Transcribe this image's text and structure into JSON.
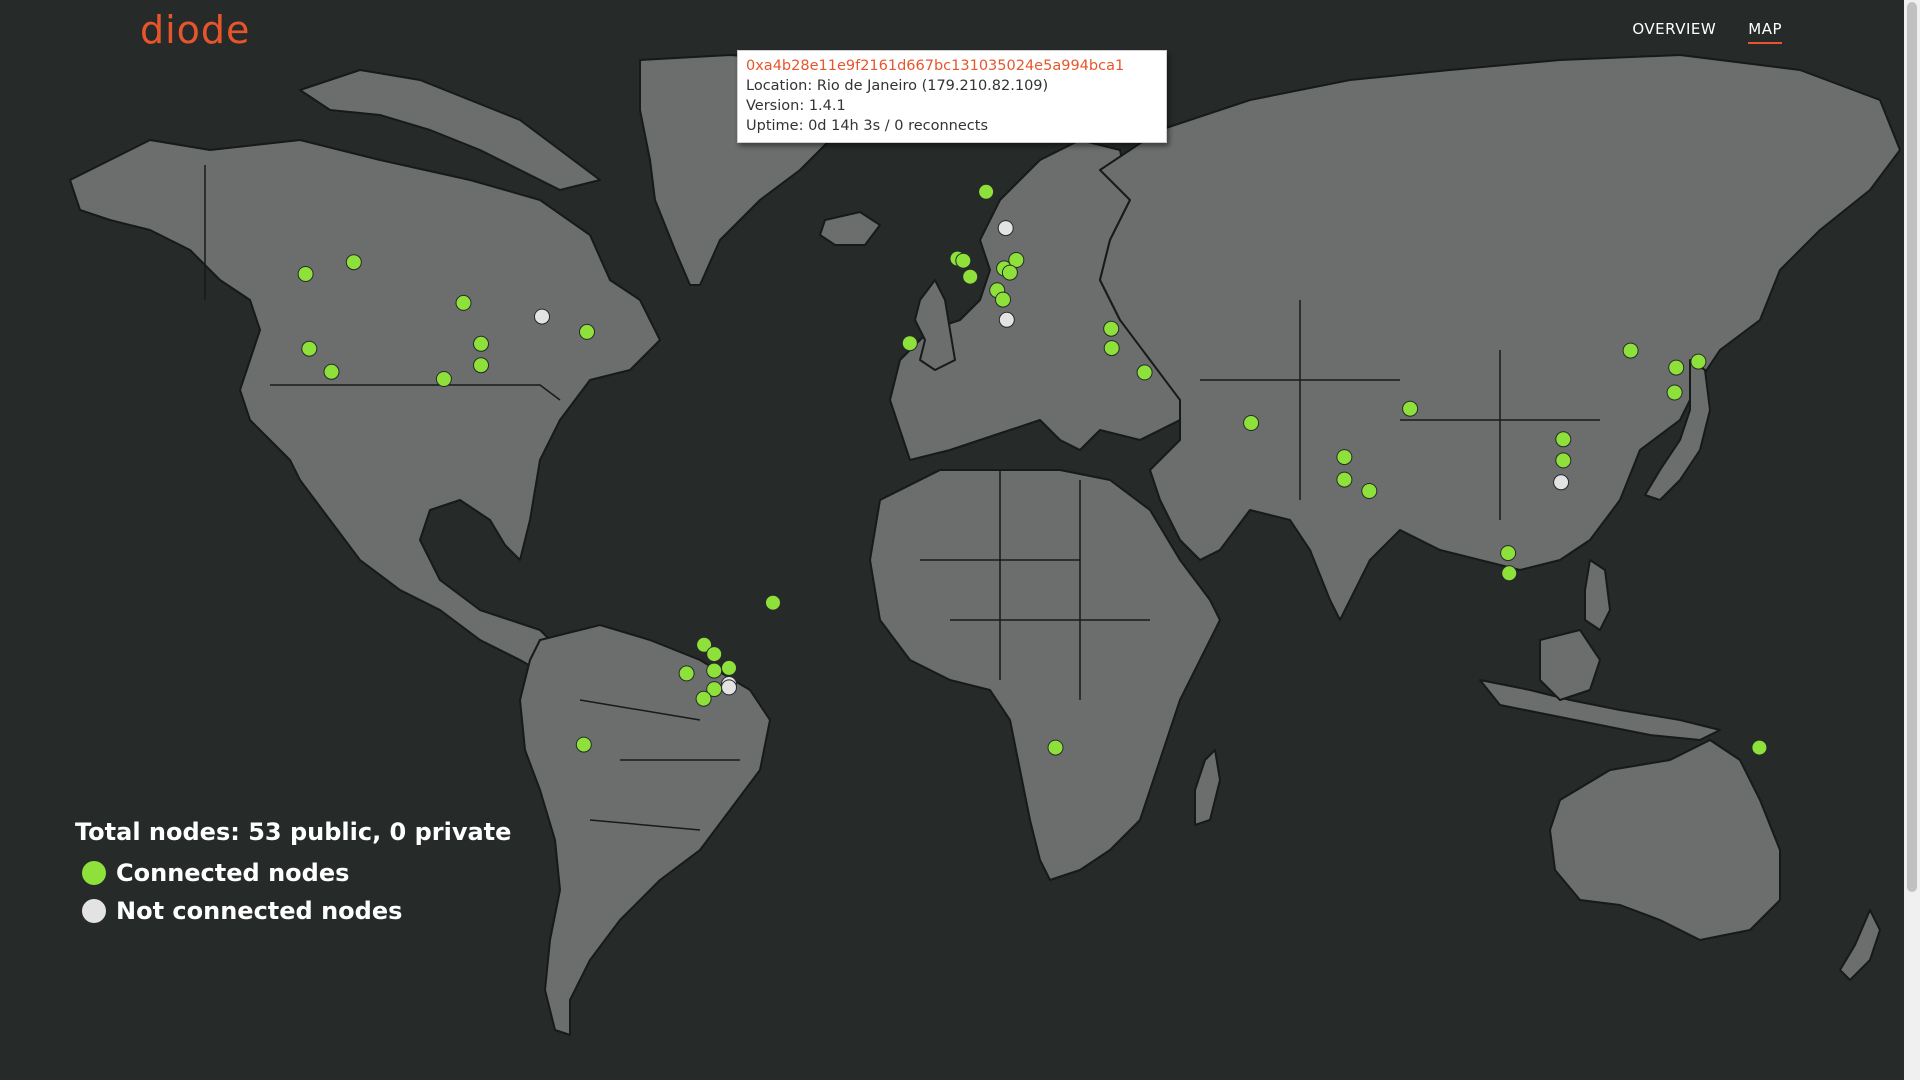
{
  "header": {
    "logo_text": "diode",
    "nav": [
      {
        "label": "OVERVIEW",
        "active": false
      },
      {
        "label": "MAP",
        "active": true
      }
    ]
  },
  "tooltip": {
    "address": "0xa4b28e11e9f2161d667bc131035024e5a994bca1",
    "location": "Location: Rio de Janeiro (179.210.82.109)",
    "version": "Version: 1.4.1",
    "uptime": "Uptime: 0d 14h 3s / 0 reconnects"
  },
  "legend": {
    "total": "Total nodes: 53 public, 0 private",
    "connected_label": "Connected nodes",
    "not_connected_label": "Not connected nodes"
  },
  "colors": {
    "connected": "#8ee03b",
    "not_connected": "#e3e3e3",
    "accent": "#e8552c",
    "land": "#6b6e6d",
    "ocean": "#262b2a"
  },
  "nodes": [
    {
      "lon": -114.0,
      "lat": 51.0,
      "connected": true
    },
    {
      "lon": -123.1,
      "lat": 49.3,
      "connected": true
    },
    {
      "lon": -122.4,
      "lat": 37.8,
      "connected": true
    },
    {
      "lon": -118.2,
      "lat": 34.0,
      "connected": true
    },
    {
      "lon": -93.3,
      "lat": 45.0,
      "connected": true
    },
    {
      "lon": -90.0,
      "lat": 38.6,
      "connected": true
    },
    {
      "lon": -90.0,
      "lat": 35.1,
      "connected": true
    },
    {
      "lon": -97.0,
      "lat": 32.8,
      "connected": true
    },
    {
      "lon": -78.5,
      "lat": 42.9,
      "connected": false
    },
    {
      "lon": -70.0,
      "lat": 40.5,
      "connected": true
    },
    {
      "lon": 5.3,
      "lat": 60.4,
      "connected": true
    },
    {
      "lon": 9.0,
      "lat": 55.7,
      "connected": false
    },
    {
      "lon": -0.1,
      "lat": 51.5,
      "connected": true
    },
    {
      "lon": 1.0,
      "lat": 51.2,
      "connected": true
    },
    {
      "lon": 2.3,
      "lat": 48.9,
      "connected": true
    },
    {
      "lon": 8.7,
      "lat": 50.1,
      "connected": true
    },
    {
      "lon": 11.0,
      "lat": 51.3,
      "connected": true
    },
    {
      "lon": 9.8,
      "lat": 49.5,
      "connected": true
    },
    {
      "lon": 7.4,
      "lat": 46.9,
      "connected": true
    },
    {
      "lon": 8.5,
      "lat": 45.5,
      "connected": true
    },
    {
      "lon": 9.2,
      "lat": 42.4,
      "connected": false
    },
    {
      "lon": -9.1,
      "lat": 38.7,
      "connected": true
    },
    {
      "lon": 28.9,
      "lat": 41.0,
      "connected": true
    },
    {
      "lon": 29.0,
      "lat": 37.9,
      "connected": true
    },
    {
      "lon": 35.2,
      "lat": 33.9,
      "connected": true
    },
    {
      "lon": 55.3,
      "lat": 25.2,
      "connected": true
    },
    {
      "lon": 72.9,
      "lat": 19.1,
      "connected": true
    },
    {
      "lon": 72.9,
      "lat": 15.0,
      "connected": true
    },
    {
      "lon": 77.6,
      "lat": 12.9,
      "connected": true
    },
    {
      "lon": 85.3,
      "lat": 27.7,
      "connected": true
    },
    {
      "lon": 114.2,
      "lat": 22.3,
      "connected": true
    },
    {
      "lon": 114.2,
      "lat": 18.5,
      "connected": true
    },
    {
      "lon": 113.8,
      "lat": 14.5,
      "connected": false
    },
    {
      "lon": 103.8,
      "lat": 1.3,
      "connected": true
    },
    {
      "lon": 104.0,
      "lat": -2.5,
      "connected": true
    },
    {
      "lon": 126.9,
      "lat": 37.5,
      "connected": true
    },
    {
      "lon": 135.5,
      "lat": 34.7,
      "connected": true
    },
    {
      "lon": 139.7,
      "lat": 35.7,
      "connected": true
    },
    {
      "lon": 135.2,
      "lat": 30.5,
      "connected": true
    },
    {
      "lon": 151.2,
      "lat": -33.9,
      "connected": true
    },
    {
      "lon": 18.4,
      "lat": -33.9,
      "connected": true
    },
    {
      "lon": -34.9,
      "lat": -8.0,
      "connected": true
    },
    {
      "lon": -47.9,
      "lat": -15.8,
      "connected": true
    },
    {
      "lon": -46.0,
      "lat": -17.5,
      "connected": true
    },
    {
      "lon": -51.2,
      "lat": -21.0,
      "connected": true
    },
    {
      "lon": -46.0,
      "lat": -20.5,
      "connected": true
    },
    {
      "lon": -43.2,
      "lat": -20.0,
      "connected": true
    },
    {
      "lon": -43.2,
      "lat": -22.9,
      "connected": false
    },
    {
      "lon": -43.2,
      "lat": -23.5,
      "connected": false
    },
    {
      "lon": -46.0,
      "lat": -23.8,
      "connected": true
    },
    {
      "lon": -48.0,
      "lat": -25.5,
      "connected": true
    },
    {
      "lon": -70.6,
      "lat": -33.4,
      "connected": true
    }
  ]
}
